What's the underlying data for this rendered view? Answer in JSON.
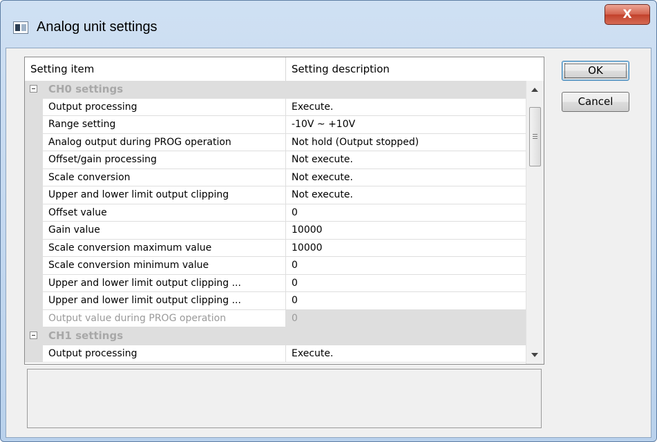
{
  "window": {
    "title": "Analog unit settings",
    "close_label": "X"
  },
  "buttons": {
    "ok_label": "OK",
    "cancel_label": "Cancel"
  },
  "grid": {
    "columns": [
      "Setting item",
      "Setting description"
    ],
    "ch0": {
      "label": "CH0 settings",
      "items": [
        {
          "name": "Output processing",
          "value": "Execute."
        },
        {
          "name": "Range setting",
          "value": "-10V ~ +10V"
        },
        {
          "name": "Analog output during PROG operation",
          "value": "Not hold (Output stopped)"
        },
        {
          "name": "Offset/gain processing",
          "value": "Not execute."
        },
        {
          "name": "Scale conversion",
          "value": "Not execute."
        },
        {
          "name": "Upper and lower limit output clipping",
          "value": "Not execute."
        },
        {
          "name": "Offset value",
          "value": "0"
        },
        {
          "name": "Gain value",
          "value": "10000"
        },
        {
          "name": "Scale conversion maximum value",
          "value": "10000"
        },
        {
          "name": "Scale conversion minimum value",
          "value": "0"
        },
        {
          "name": "Upper and lower limit output clipping ...",
          "value": "0"
        },
        {
          "name": "Upper and lower limit output clipping ...",
          "value": "0"
        },
        {
          "name": "Output value during PROG operation",
          "value": "0",
          "disabled": true
        }
      ]
    },
    "ch1": {
      "label": "CH1 settings",
      "items": [
        {
          "name": "Output processing",
          "value": "Execute."
        }
      ]
    }
  },
  "description": ""
}
